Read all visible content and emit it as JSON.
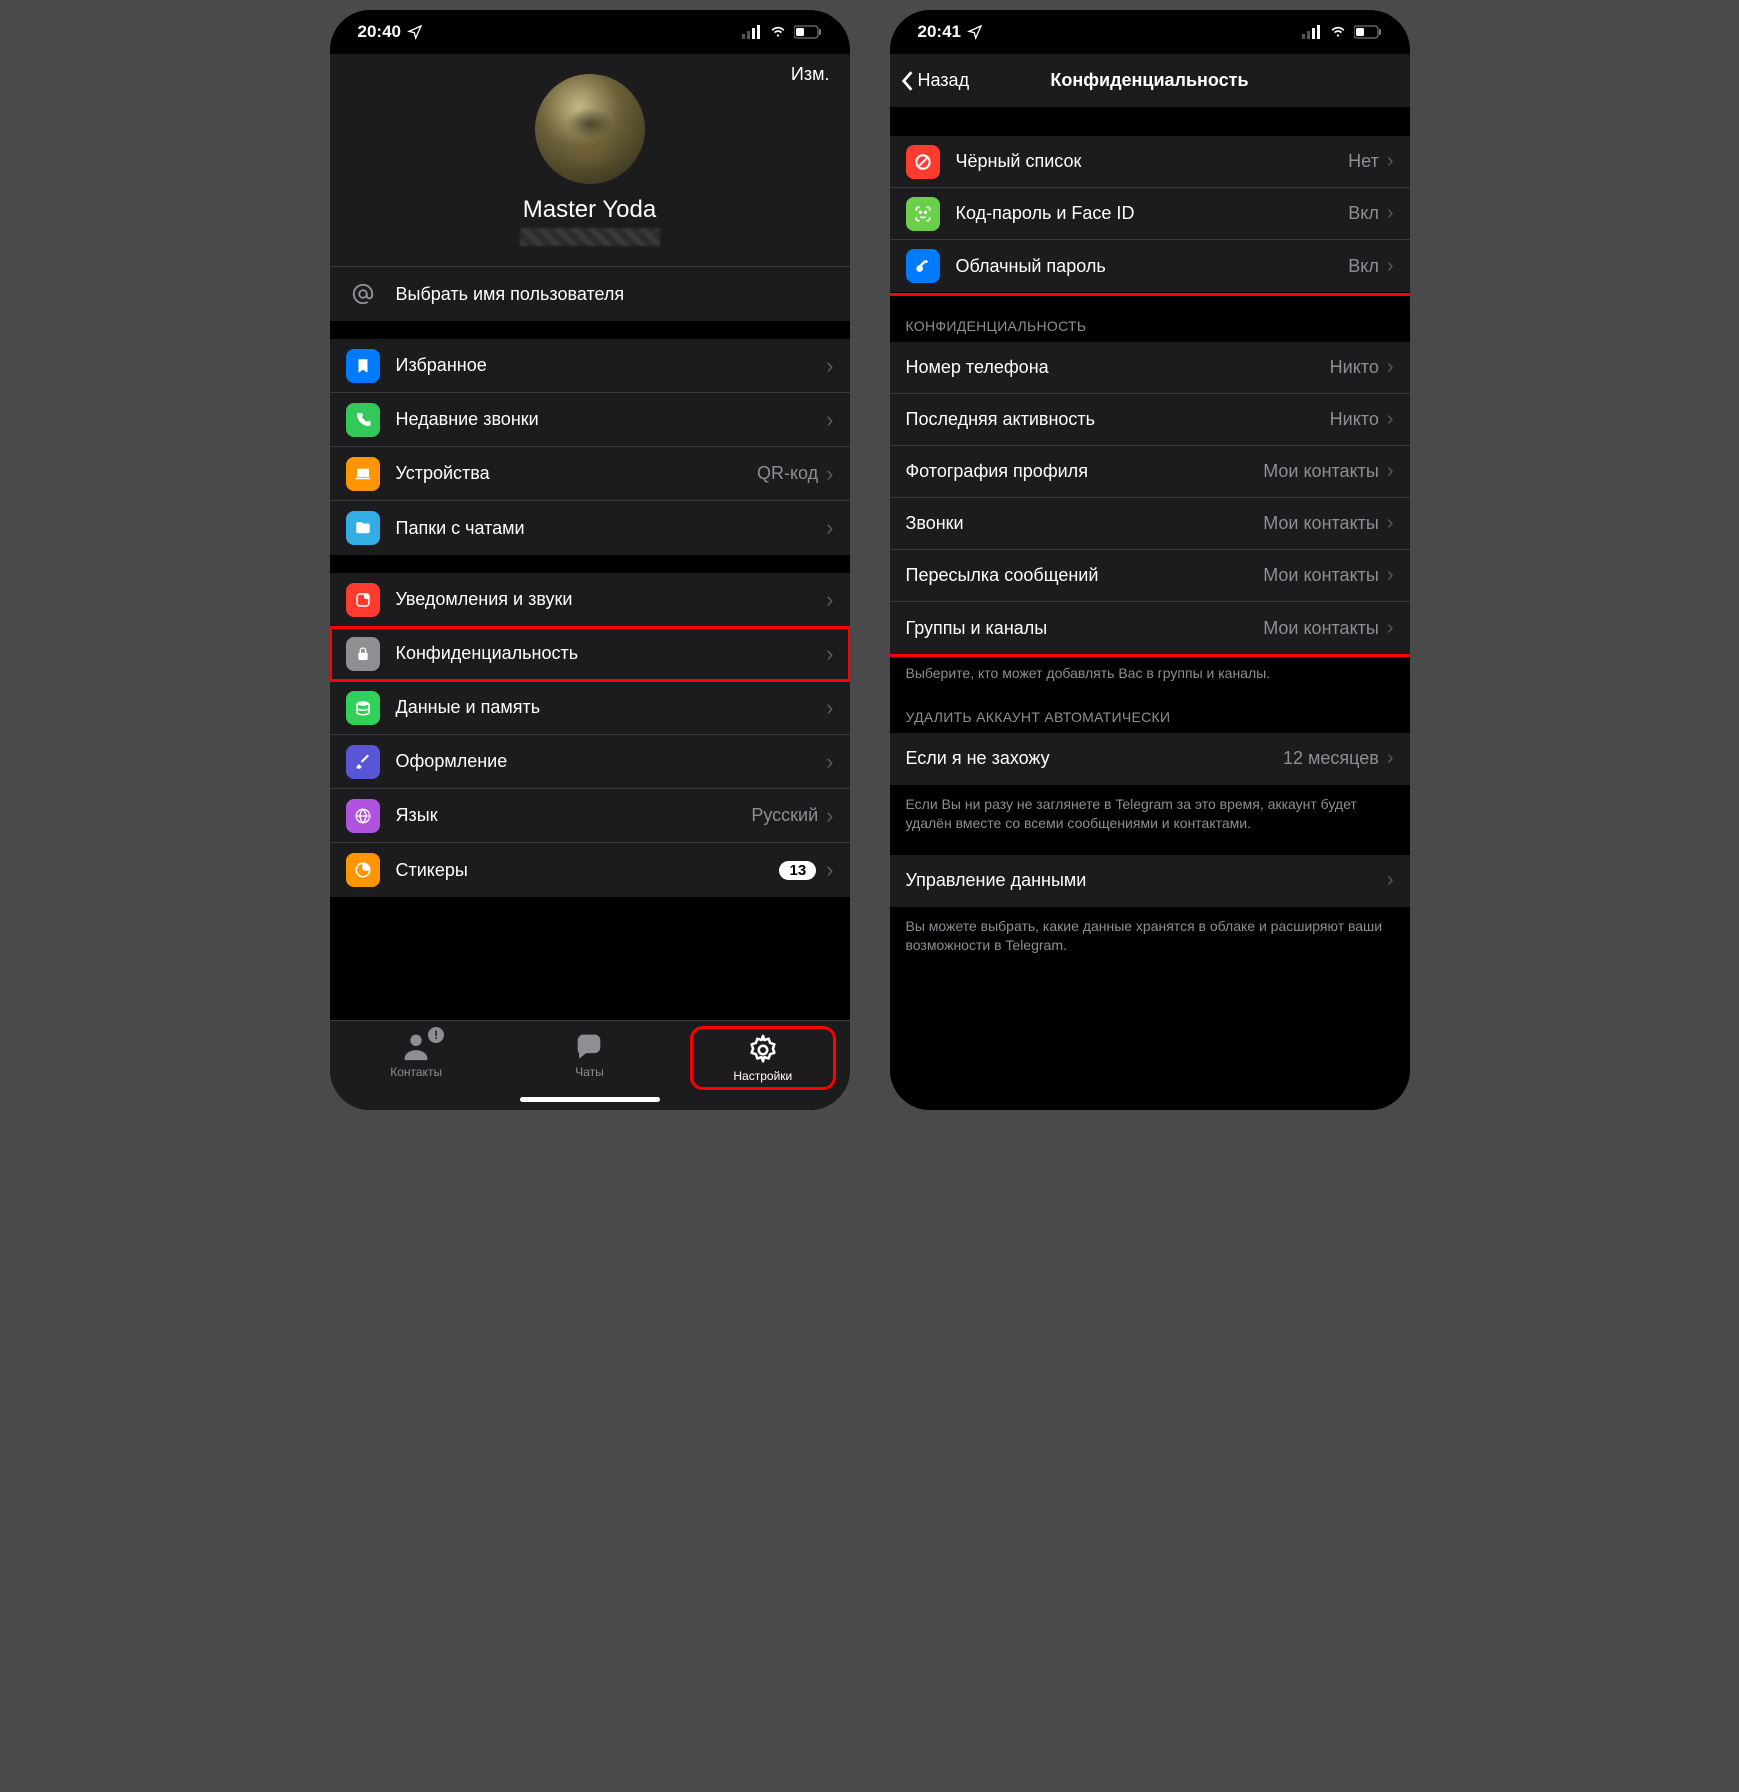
{
  "left": {
    "status_time": "20:40",
    "edit": "Изм.",
    "profile_name": "Master Yoda",
    "username_row": "Выбрать имя пользователя",
    "rows1": [
      {
        "label": "Избранное"
      },
      {
        "label": "Недавние звонки"
      },
      {
        "label": "Устройства",
        "value": "QR-код"
      },
      {
        "label": "Папки с чатами"
      }
    ],
    "rows2": [
      {
        "label": "Уведомления и звуки"
      },
      {
        "label": "Конфиденциальность"
      },
      {
        "label": "Данные и память"
      },
      {
        "label": "Оформление"
      },
      {
        "label": "Язык",
        "value": "Русский"
      },
      {
        "label": "Стикеры",
        "badge": "13"
      }
    ],
    "tabs": {
      "contacts": "Контакты",
      "chats": "Чаты",
      "settings": "Настройки"
    }
  },
  "right": {
    "status_time": "20:41",
    "back": "Назад",
    "title": "Конфиденциальность",
    "security": [
      {
        "label": "Чёрный список",
        "value": "Нет"
      },
      {
        "label": "Код-пароль и Face ID",
        "value": "Вкл"
      },
      {
        "label": "Облачный пароль",
        "value": "Вкл"
      }
    ],
    "privacy_header": "КОНФИДЕНЦИАЛЬНОСТЬ",
    "privacy": [
      {
        "label": "Номер телефона",
        "value": "Никто"
      },
      {
        "label": "Последняя активность",
        "value": "Никто"
      },
      {
        "label": "Фотография профиля",
        "value": "Мои контакты"
      },
      {
        "label": "Звонки",
        "value": "Мои контакты"
      },
      {
        "label": "Пересылка сообщений",
        "value": "Мои контакты"
      },
      {
        "label": "Группы и каналы",
        "value": "Мои контакты"
      }
    ],
    "privacy_footer": "Выберите, кто может добавлять Вас в группы и каналы.",
    "delete_header": "УДАЛИТЬ АККАУНТ АВТОМАТИЧЕСКИ",
    "delete_row": {
      "label": "Если я не захожу",
      "value": "12 месяцев"
    },
    "delete_footer": "Если Вы ни разу не заглянете в Telegram за это время, аккаунт будет удалён вместе со всеми сообщениями и контактами.",
    "data_row": {
      "label": "Управление данными"
    },
    "data_footer": "Вы можете выбрать, какие данные хранятся в облаке и расширяют ваши возможности в Telegram."
  }
}
